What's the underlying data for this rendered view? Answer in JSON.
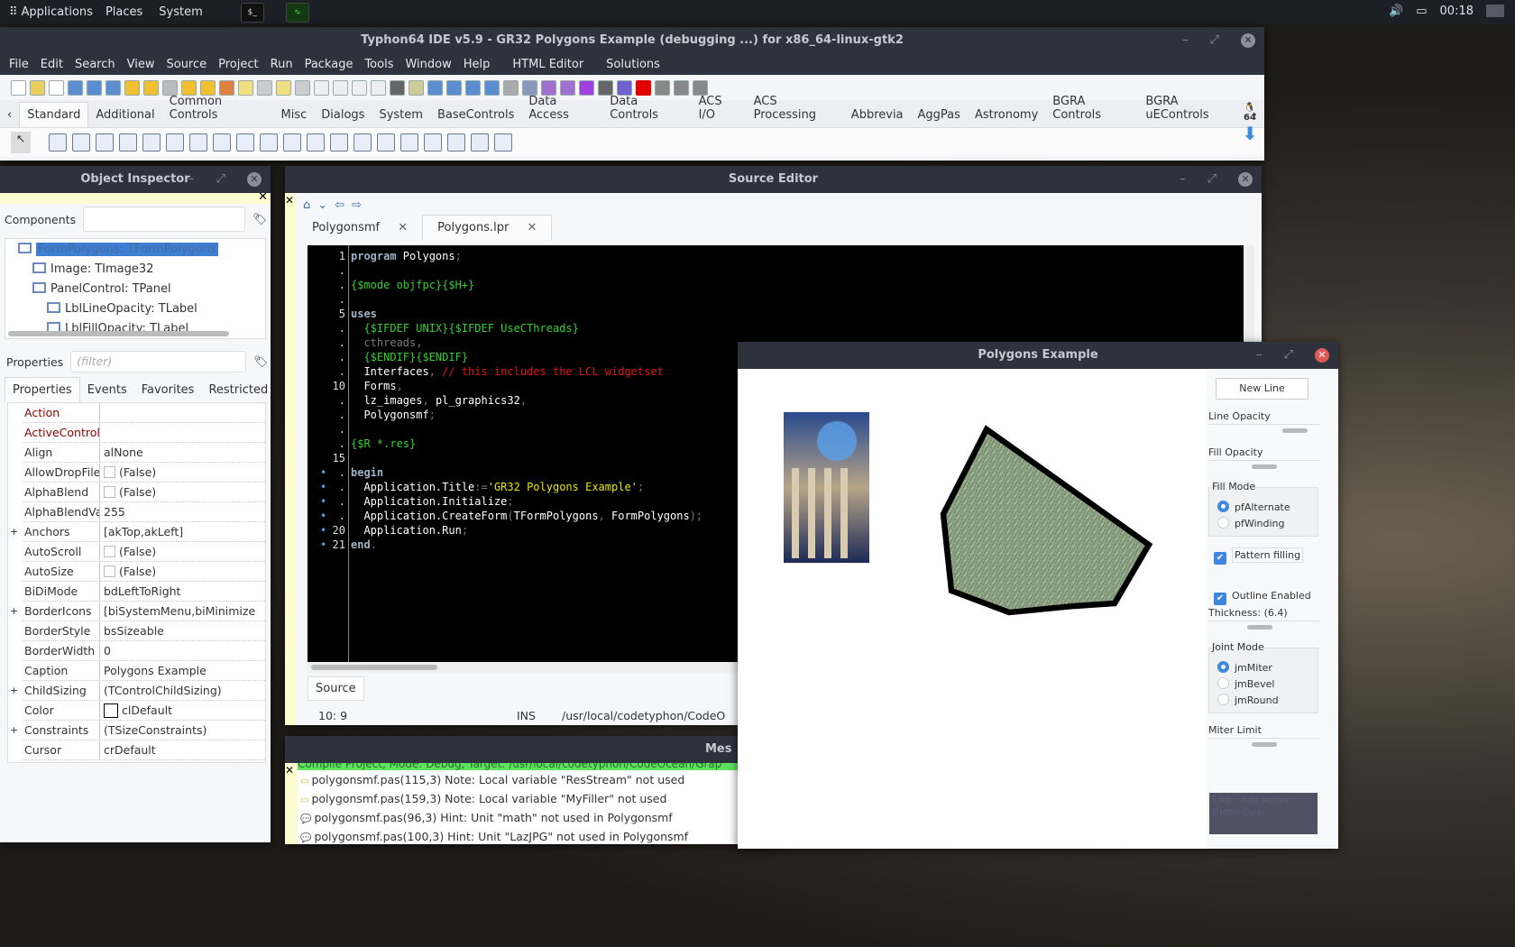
{
  "top_panel": {
    "applications": "Applications",
    "places": "Places",
    "system": "System",
    "clock": "00:18"
  },
  "ide": {
    "title": "Typhon64 IDE v5.9 - GR32 Polygons Example (debugging ...) for x86_64-linux-gtk2",
    "menu": [
      "File",
      "Edit",
      "Search",
      "View",
      "Source",
      "Project",
      "Run",
      "Package",
      "Tools",
      "Window",
      "Help",
      "HTML Editor",
      "Solutions"
    ],
    "palette_tabs": [
      "Standard",
      "Additional",
      "Common Controls",
      "Misc",
      "Dialogs",
      "System",
      "BaseControls",
      "Data Access",
      "Data Controls",
      "ACS I/O",
      "ACS Processing",
      "Abbrevia",
      "AggPas",
      "Astronomy",
      "BGRA Controls",
      "BGRA uEControls"
    ],
    "arch_badge": "64",
    "colors": {
      "titlebar": "#2e323d",
      "stop": "#e00000"
    }
  },
  "inspector": {
    "title": "Object Inspector",
    "components_label": "Components",
    "tree": [
      {
        "label": "FormPolygons: TFormPolygons",
        "level": 0,
        "selected": true
      },
      {
        "label": "Image: TImage32",
        "level": 1
      },
      {
        "label": "PanelControl: TPanel",
        "level": 1
      },
      {
        "label": "LblLineOpacity: TLabel",
        "level": 2
      },
      {
        "label": "LblFillOpacity: TLabel",
        "level": 2
      }
    ],
    "properties_label": "Properties",
    "filter_placeholder": "(filter)",
    "tabs": [
      "Properties",
      "Events",
      "Favorites",
      "Restricted"
    ],
    "props": [
      {
        "name": "Action",
        "value": "",
        "red": true
      },
      {
        "name": "ActiveControl",
        "value": "",
        "red": true
      },
      {
        "name": "Align",
        "value": "alNone"
      },
      {
        "name": "AllowDropFiles",
        "value": "(False)",
        "check": true
      },
      {
        "name": "AlphaBlend",
        "value": "(False)",
        "check": true
      },
      {
        "name": "AlphaBlendValue",
        "value": "255"
      },
      {
        "name": "Anchors",
        "value": "[akTop,akLeft]",
        "expand": true
      },
      {
        "name": "AutoScroll",
        "value": "(False)",
        "check": true
      },
      {
        "name": "AutoSize",
        "value": "(False)",
        "check": true
      },
      {
        "name": "BiDiMode",
        "value": "bdLeftToRight"
      },
      {
        "name": "BorderIcons",
        "value": "[biSystemMenu,biMinimize",
        "expand": true
      },
      {
        "name": "BorderStyle",
        "value": "bsSizeable"
      },
      {
        "name": "BorderWidth",
        "value": "0"
      },
      {
        "name": "Caption",
        "value": "Polygons Example"
      },
      {
        "name": "ChildSizing",
        "value": "(TControlChildSizing)",
        "expand": true
      },
      {
        "name": "Color",
        "value": "clDefault",
        "swatch": true
      },
      {
        "name": "Constraints",
        "value": "(TSizeConstraints)",
        "expand": true
      },
      {
        "name": "Cursor",
        "value": "crDefault"
      }
    ]
  },
  "editor": {
    "title": "Source Editor",
    "tabs": [
      {
        "label": "Polygonsmf"
      },
      {
        "label": "Polygons.lpr",
        "active": true
      }
    ],
    "gutter": [
      "1",
      ".",
      ".",
      ".",
      "5",
      ".",
      ".",
      ".",
      ".",
      "10",
      ".",
      ".",
      ".",
      ".",
      "15",
      ".",
      ".",
      ".",
      ".",
      "20",
      "21"
    ],
    "breakpoints": [
      15,
      16,
      17,
      18,
      19,
      20
    ],
    "lines": [
      [
        [
          "kw",
          "program"
        ],
        [
          "wh",
          " Polygons"
        ],
        [
          "gr",
          ";"
        ]
      ],
      [],
      [
        [
          "dir",
          "{$mode objfpc}{$H+}"
        ]
      ],
      [],
      [
        [
          "kw",
          "uses"
        ]
      ],
      [
        [
          "dir",
          "  {$IFDEF UNIX}{$IFDEF UseCThreads}"
        ]
      ],
      [
        [
          "gr",
          "  cthreads,"
        ]
      ],
      [
        [
          "dir",
          "  {$ENDIF}{$ENDIF}"
        ]
      ],
      [
        [
          "wh",
          "  Interfaces"
        ],
        [
          "gr",
          ", "
        ],
        [
          "cm",
          "// this includes the LCL widgetset"
        ]
      ],
      [
        [
          "wh",
          "  Forms"
        ],
        [
          "gr",
          ","
        ]
      ],
      [
        [
          "wh",
          "  lz_images"
        ],
        [
          "gr",
          ", "
        ],
        [
          "wh",
          "pl_graphics32"
        ],
        [
          "gr",
          ","
        ]
      ],
      [
        [
          "wh",
          "  Polygonsmf"
        ],
        [
          "gr",
          ";"
        ]
      ],
      [],
      [
        [
          "dir",
          "{$R *.res}"
        ]
      ],
      [],
      [
        [
          "kw",
          "begin"
        ]
      ],
      [
        [
          "wh",
          "  Application.Title"
        ],
        [
          "gr",
          ":="
        ],
        [
          "str",
          "'GR32 Polygons Example'"
        ],
        [
          "gr",
          ";"
        ]
      ],
      [
        [
          "wh",
          "  Application.Initialize"
        ],
        [
          "gr",
          ";"
        ]
      ],
      [
        [
          "wh",
          "  Application.CreateForm"
        ],
        [
          "gr",
          "("
        ],
        [
          "wh",
          "TFormPolygons"
        ],
        [
          "gr",
          ", "
        ],
        [
          "wh",
          "FormPolygons"
        ],
        [
          "gr",
          ");"
        ]
      ],
      [
        [
          "wh",
          "  Application.Run"
        ],
        [
          "gr",
          ";"
        ]
      ],
      [
        [
          "kw",
          "end"
        ],
        [
          "gr",
          "."
        ]
      ]
    ],
    "bottom_tab": "Source",
    "status": {
      "pos": "10:  9",
      "mode": "INS",
      "path": "/usr/local/codetyphon/CodeO"
    }
  },
  "messages": {
    "title": "Mes",
    "header": "Compile Project, Mode: Debug, Target: /usr/local/codetyphon/CodeOcean/Grap",
    "items": [
      {
        "type": "note",
        "text": "polygonsmf.pas(115,3) Note: Local variable \"ResStream\" not used"
      },
      {
        "type": "note",
        "text": "polygonsmf.pas(159,3) Note: Local variable \"MyFiller\" not used"
      },
      {
        "type": "hint",
        "text": "polygonsmf.pas(96,3) Hint: Unit \"math\" not used in Polygonsmf"
      },
      {
        "type": "hint",
        "text": "polygonsmf.pas(100,3) Hint: Unit \"LazJPG\" not used in Polygonsmf"
      }
    ]
  },
  "polyform": {
    "title": "Polygons Example",
    "new_line": "New Line",
    "line_opacity": "Line Opacity",
    "line_opacity_value": 0.85,
    "fill_opacity": "Fill Opacity",
    "fill_opacity_value": 0.5,
    "fill_mode": {
      "label": "Fill Mode",
      "options": [
        "pfAlternate",
        "pfWinding"
      ],
      "selected": "pfAlternate"
    },
    "pattern_filling": {
      "label": "Pattern filling",
      "checked": true
    },
    "outline_enabled": {
      "label": "Outline Enabled",
      "checked": true
    },
    "thickness": "Thickness: (6.4)",
    "thickness_value": 0.45,
    "joint_mode": {
      "label": "Joint Mode",
      "options": [
        "jmMiter",
        "jmBevel",
        "jmRound"
      ],
      "selected": "jmMiter"
    },
    "miter_limit": "Miter Limit",
    "miter_limit_value": 0.5,
    "help": [
      "LMB - Add vertex",
      "RMB - Clear"
    ],
    "colors": {
      "fill": "#8fa485",
      "outline": "#000000",
      "help_bg": "#4f5265"
    }
  }
}
